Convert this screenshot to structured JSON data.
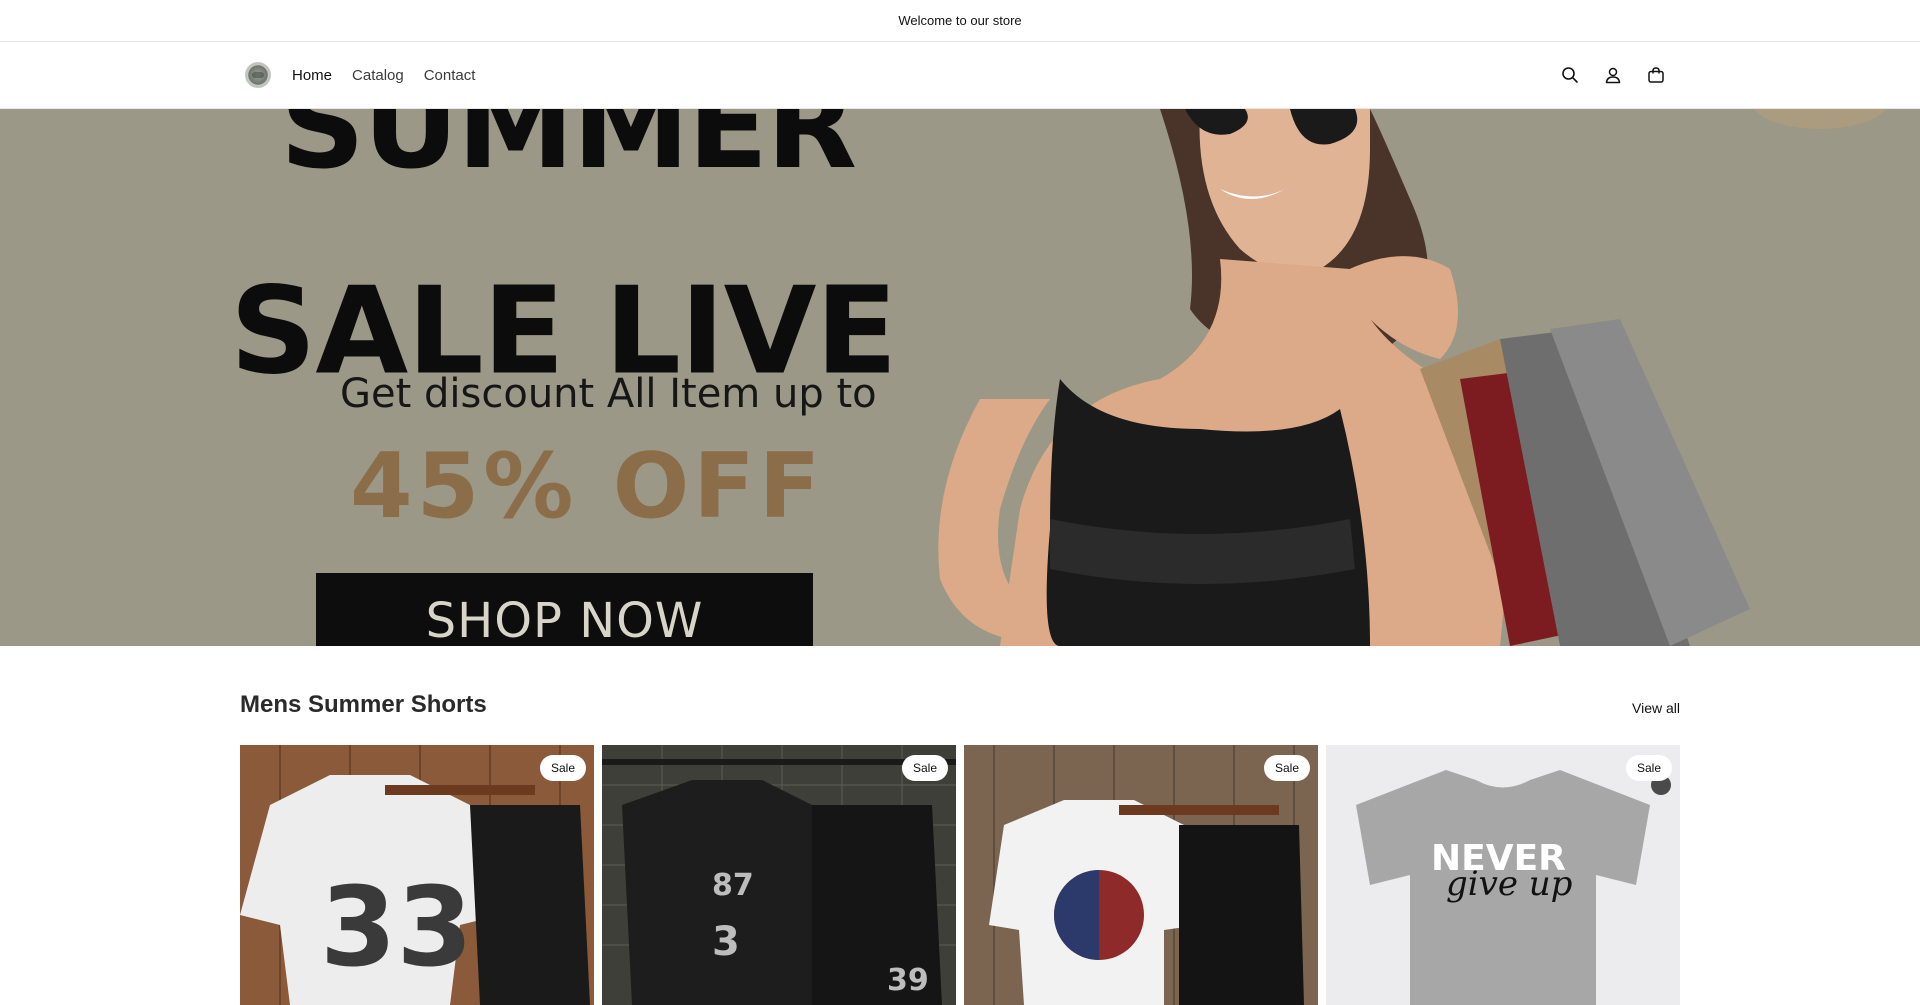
{
  "announcement": "Welcome to our store",
  "nav": {
    "items": [
      "Home",
      "Catalog",
      "Contact"
    ]
  },
  "header_icons": [
    "search-icon",
    "account-icon",
    "cart-icon"
  ],
  "hero": {
    "line1": "SUMMER",
    "line2": "SALE LIVE",
    "subtitle": "Get discount All Item up to",
    "discount": "45% OFF",
    "button": "SHOP NOW",
    "background_color": "#9c9887",
    "discount_color": "#8b6d4a"
  },
  "section": {
    "title": "Mens Summer Shorts",
    "view_all": "View all",
    "products": [
      {
        "badge": "Sale"
      },
      {
        "badge": "Sale"
      },
      {
        "badge": "Sale"
      },
      {
        "badge": "Sale"
      }
    ]
  }
}
